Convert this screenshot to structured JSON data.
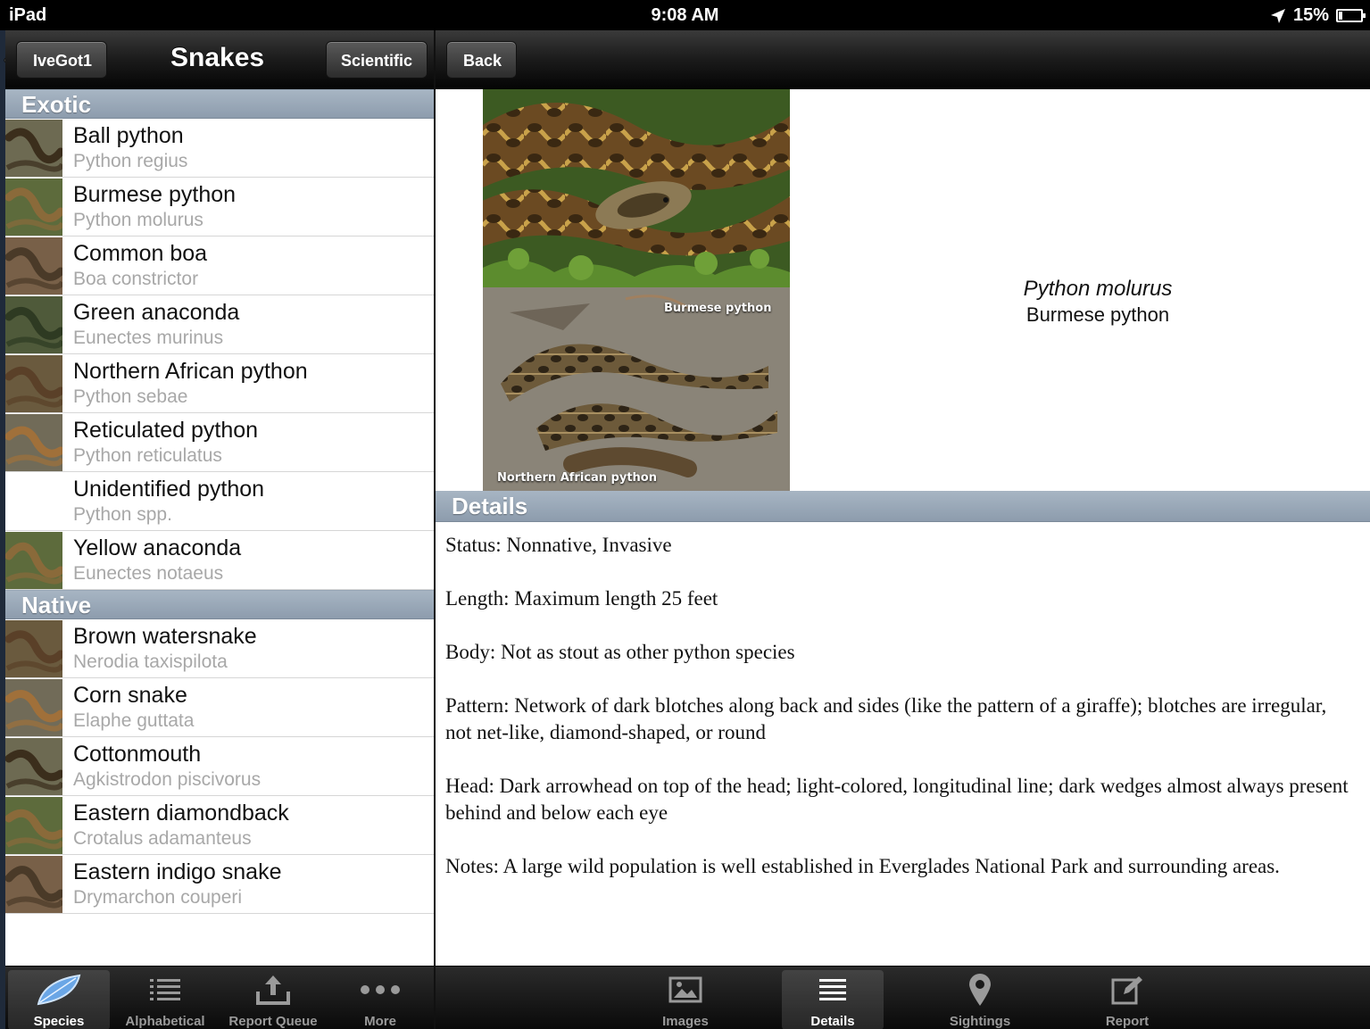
{
  "status_bar": {
    "carrier": "iPad",
    "time": "9:08 AM",
    "battery": "15%",
    "battery_level": 0.15
  },
  "left_nav": {
    "back_label": "IveGot1",
    "title": "Snakes",
    "toggle_label": "Scientific"
  },
  "right_nav": {
    "back_label": "Back"
  },
  "sections": [
    {
      "title": "Exotic",
      "items": [
        {
          "common": "Ball python",
          "scientific": "Python regius",
          "thumb": "snake"
        },
        {
          "common": "Burmese python",
          "scientific": "Python molurus",
          "thumb": "snake"
        },
        {
          "common": "Common boa",
          "scientific": "Boa constrictor",
          "thumb": "snake"
        },
        {
          "common": "Green anaconda",
          "scientific": "Eunectes murinus",
          "thumb": "snake"
        },
        {
          "common": "Northern African python",
          "scientific": "Python sebae",
          "thumb": "snake"
        },
        {
          "common": "Reticulated python",
          "scientific": "Python reticulatus",
          "thumb": "snake"
        },
        {
          "common": "Unidentified python",
          "scientific": "Python spp.",
          "thumb": "none"
        },
        {
          "common": "Yellow anaconda",
          "scientific": "Eunectes notaeus",
          "thumb": "snake"
        }
      ]
    },
    {
      "title": "Native",
      "items": [
        {
          "common": "Brown watersnake",
          "scientific": "Nerodia taxispilota",
          "thumb": "snake"
        },
        {
          "common": "Corn snake",
          "scientific": "Elaphe guttata",
          "thumb": "snake"
        },
        {
          "common": "Cottonmouth",
          "scientific": "Agkistrodon piscivorus",
          "thumb": "snake"
        },
        {
          "common": "Eastern diamondback",
          "scientific": "Crotalus adamanteus",
          "thumb": "snake"
        },
        {
          "common": "Eastern indigo snake",
          "scientific": "Drymarchon couperi",
          "thumb": "snake"
        }
      ]
    }
  ],
  "detail": {
    "photo_caption_top": "Burmese python",
    "photo_caption_bottom": "Northern African python",
    "scientific_name": "Python molurus",
    "common_name": "Burmese python",
    "details_header": "Details",
    "lines": [
      "Status: Nonnative, Invasive",
      "Length: Maximum length 25 feet",
      "Body: Not as stout as other python species",
      "Pattern: Network of dark blotches along back and sides (like the pattern of a giraffe); blotches are irregular, not net-like, diamond-shaped, or round",
      "Head: Dark arrowhead on top of the head; light-colored, longitudinal line; dark wedges almost always present behind and below each eye",
      "Notes: A large wild population is well established in Everglades National Park and surrounding areas."
    ]
  },
  "left_tabs": [
    {
      "label": "Species",
      "icon": "leaf-icon",
      "active": true
    },
    {
      "label": "Alphabetical",
      "icon": "list-icon",
      "active": false
    },
    {
      "label": "Report Queue",
      "icon": "upload-icon",
      "active": false
    },
    {
      "label": "More",
      "icon": "more-icon",
      "active": false
    }
  ],
  "right_tabs": [
    {
      "label": "Images",
      "icon": "image-icon",
      "active": false
    },
    {
      "label": "Details",
      "icon": "details-icon",
      "active": true
    },
    {
      "label": "Sightings",
      "icon": "pin-icon",
      "active": false
    },
    {
      "label": "Report",
      "icon": "compose-icon",
      "active": false
    }
  ],
  "colors": {
    "section_header": "#9aa9b8",
    "active_tab": "#ffffff",
    "inactive_tab": "#9a9a9a",
    "leaf": "#6aa6e6"
  }
}
